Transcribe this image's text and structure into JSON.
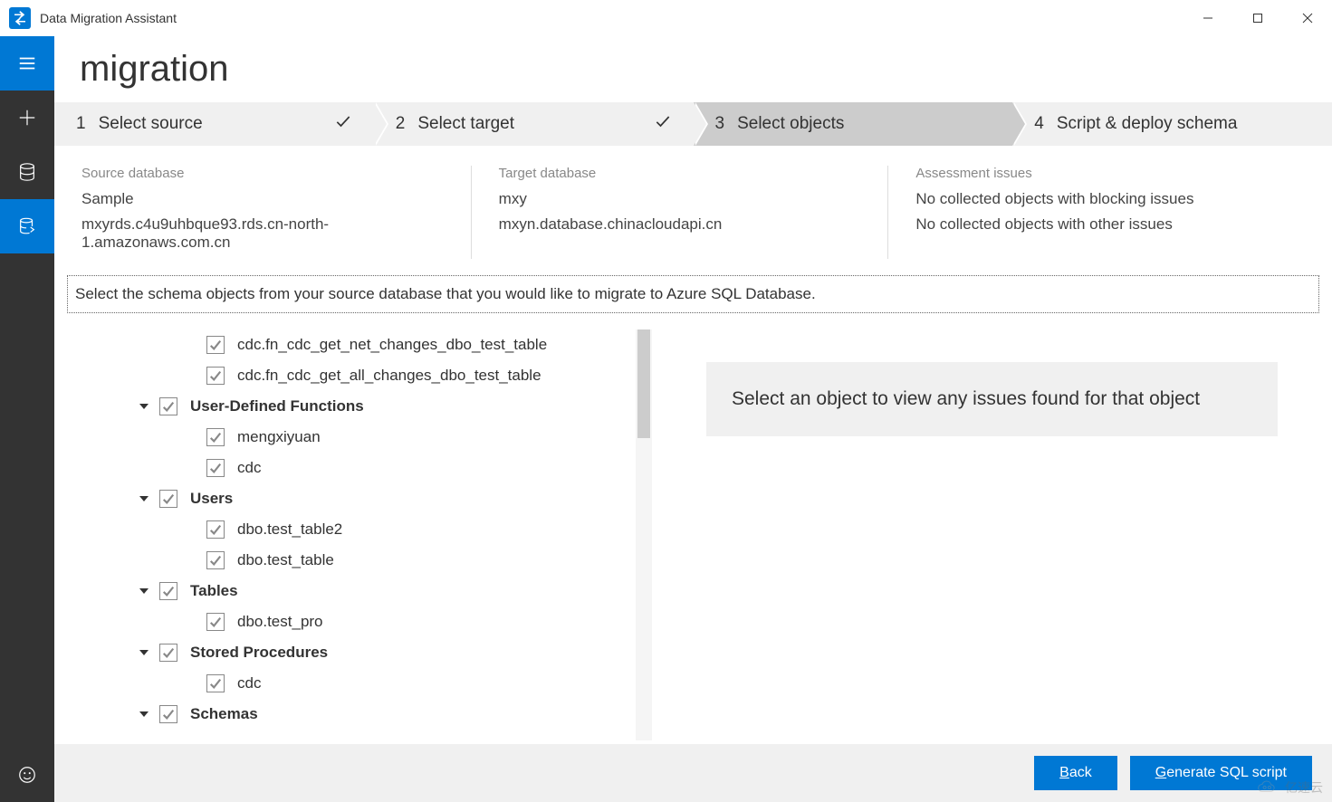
{
  "app_title": "Data Migration Assistant",
  "page_title": "migration",
  "wizard_steps": [
    {
      "num": "1",
      "label": "Select source",
      "done": true
    },
    {
      "num": "2",
      "label": "Select target",
      "done": true
    },
    {
      "num": "3",
      "label": "Select objects",
      "active": true
    },
    {
      "num": "4",
      "label": "Script & deploy schema"
    }
  ],
  "source": {
    "label": "Source database",
    "name": "Sample",
    "host": "mxyrds.c4u9uhbque93.rds.cn-north-1.amazonaws.com.cn"
  },
  "target": {
    "label": "Target database",
    "name": "mxy",
    "host": "mxyn.database.chinacloudapi.cn"
  },
  "assessment": {
    "label": "Assessment issues",
    "blocking": "No collected objects with blocking issues",
    "other": "No collected objects with other issues"
  },
  "instruction": "Select the schema objects from your source database that you would like to migrate to Azure SQL Database.",
  "tree": [
    {
      "type": "cat",
      "label": "Schemas"
    },
    {
      "type": "item",
      "label": "cdc"
    },
    {
      "type": "cat",
      "label": "Stored Procedures"
    },
    {
      "type": "item",
      "label": "dbo.test_pro"
    },
    {
      "type": "cat",
      "label": "Tables"
    },
    {
      "type": "item",
      "label": "dbo.test_table"
    },
    {
      "type": "item",
      "label": "dbo.test_table2"
    },
    {
      "type": "cat",
      "label": "Users"
    },
    {
      "type": "item",
      "label": "cdc"
    },
    {
      "type": "item",
      "label": "mengxiyuan"
    },
    {
      "type": "cat",
      "label": "User-Defined Functions"
    },
    {
      "type": "item",
      "label": "cdc.fn_cdc_get_all_changes_dbo_test_table"
    },
    {
      "type": "item",
      "label": "cdc.fn_cdc_get_net_changes_dbo_test_table"
    }
  ],
  "detail_placeholder": "Select an object to view any issues found for that object",
  "buttons": {
    "back": "Back",
    "back_ul": "B",
    "generate": "Generate SQL script",
    "generate_ul": "G"
  },
  "watermark": "亿速云"
}
